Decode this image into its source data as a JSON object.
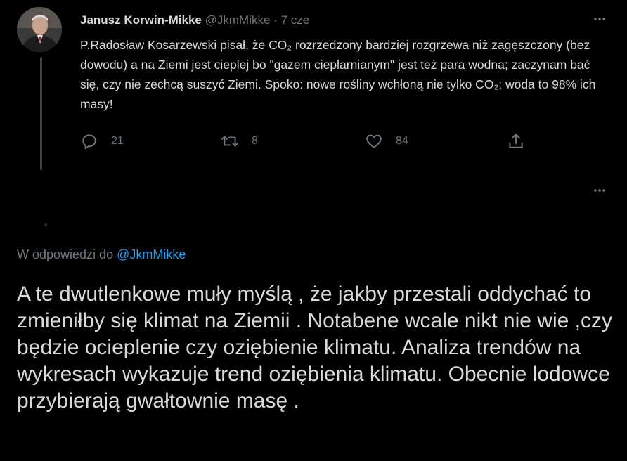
{
  "tweet": {
    "author_name": "Janusz Korwin-Mikke",
    "handle": "@JkmMikke",
    "separator": "·",
    "time": "7 cze",
    "text": "P.Radosław Kosarzewski pisał, że CO₂ rozrzedzony bardziej rozgrzewa niż zagęszczony (bez dowodu) a na Ziemi jest cieplej bo \"gazem cieplarnianym\" jest też para wodna; zaczynam bać się, czy nie zechcą suszyć Ziemi. Spoko: nowe rośliny wchłoną nie tylko CO₂; woda to 98% ich masy!",
    "actions": {
      "replies": "21",
      "retweets": "8",
      "likes": "84"
    },
    "icons": [
      "reply-icon",
      "retweet-icon",
      "like-icon",
      "share-icon",
      "more-icon"
    ]
  },
  "reply": {
    "prefix": "W odpowiedzi do",
    "to_handle": "@JkmMikke",
    "text": "A te dwutlenkowe muły myślą , że jakby przestali oddychać to zmieniłby się klimat na Ziemii . Notabene wcale nikt nie wie ,czy będzie ocieplenie czy oziębienie klimatu. Analiza trendów na wykresach wykazuje trend oziębienia klimatu. Obecnie lodowce przybierają gwałtownie masę ."
  },
  "colors": {
    "background": "#000000",
    "text": "#d9d9d9",
    "muted": "#6e767d",
    "link": "#1d9bf0",
    "thread_line": "#3d4145"
  }
}
